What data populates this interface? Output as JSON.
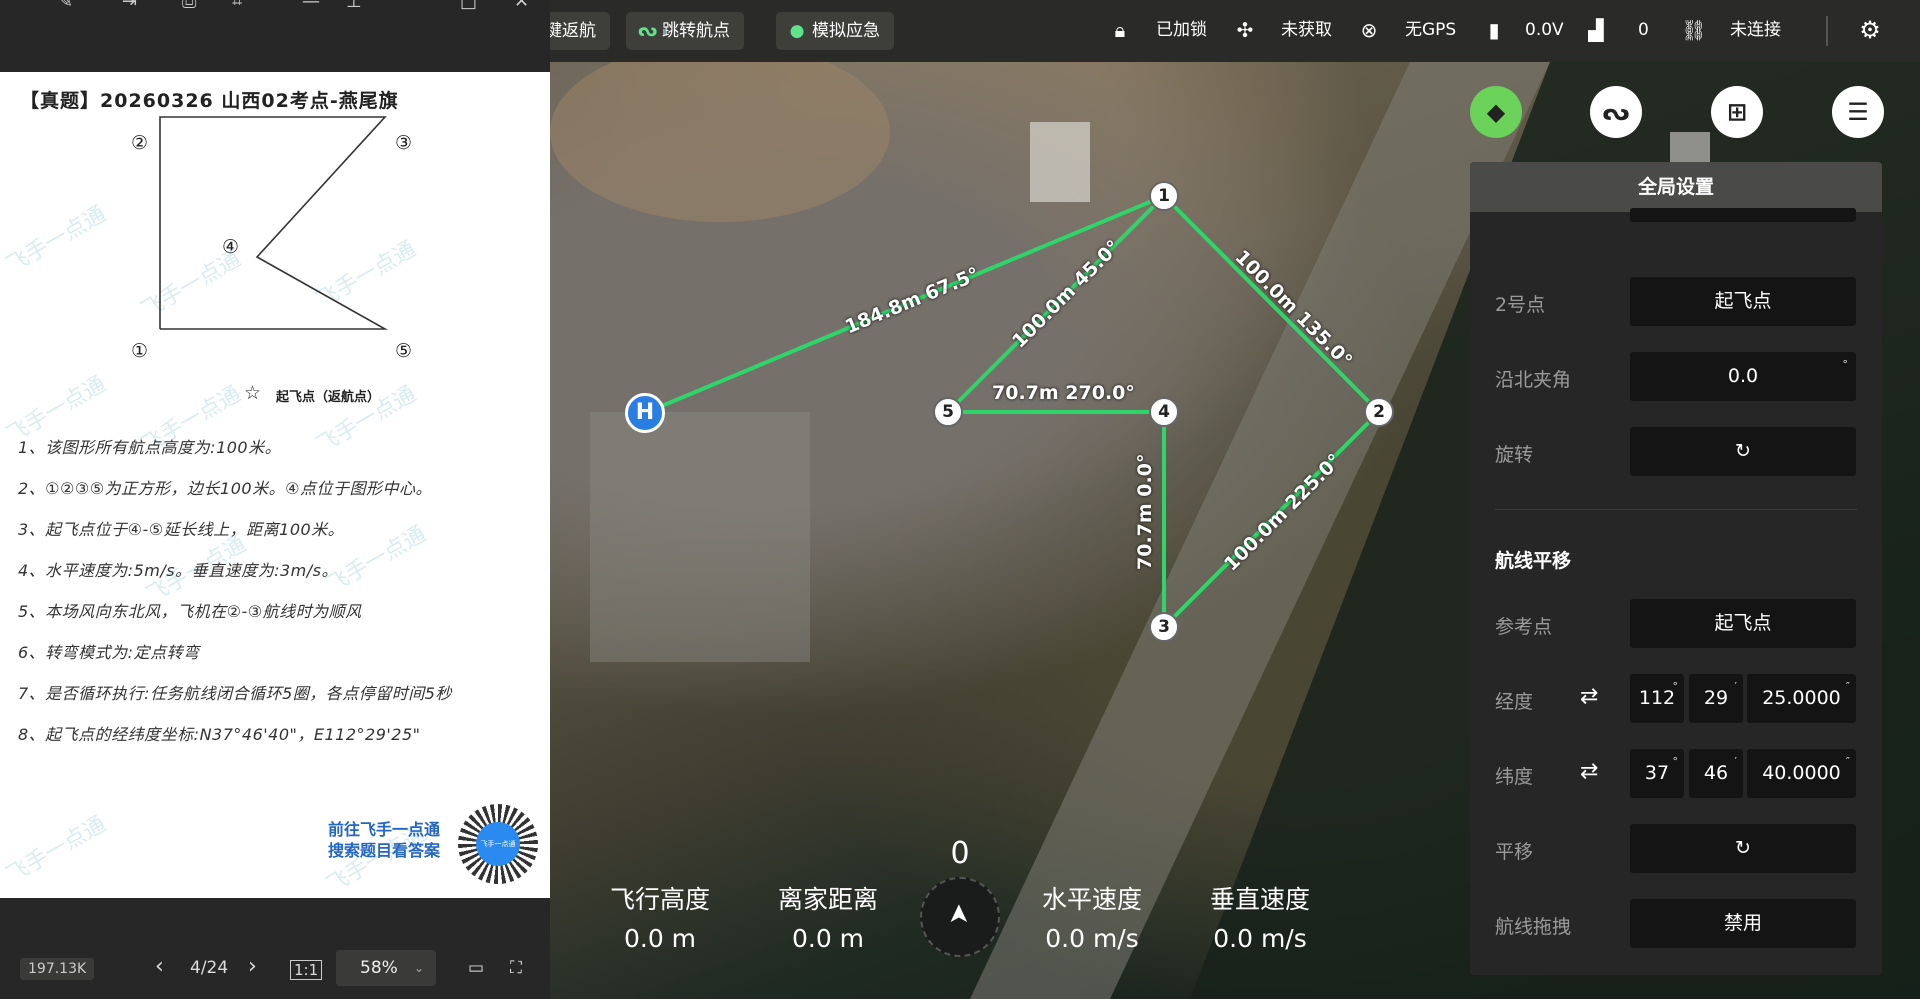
{
  "topbar": {
    "return_label": "键返航",
    "jump_label": "跳转航点",
    "sim_label": "模拟应急",
    "lock_status": "已加锁",
    "drone_status": "未获取",
    "gps_status": "无GPS",
    "voltage": "0.0V",
    "signal_value": "0",
    "connection_status": "未连接"
  },
  "viewer": {
    "doc_title": "【真题】20260326 山西02考点-燕尾旗",
    "diagram_labels": {
      "p1": "①",
      "p2": "②",
      "p3": "③",
      "p4": "④",
      "p5": "⑤",
      "takeoff": "起飞点（返航点）"
    },
    "rules": [
      "1、该图形所有航点高度为:100米。",
      "2、①②③⑤为正方形，边长100米。④点位于图形中心。",
      "3、起飞点位于④-⑤延长线上，距离100米。",
      "4、水平速度为:5m/s。垂直速度为:3m/s。",
      "5、本场风向东北风，飞机在②-③航线时为顺风",
      "6、转弯模式为:定点转弯",
      "7、是否循环执行:任务航线闭合循环5圈，各点停留时间5秒",
      "8、起飞点的经纬度坐标:N37°46'40\"，E112°29'25\""
    ],
    "watermark": "飞手一点通",
    "cta_line1": "前往飞手一点通",
    "cta_line2": "搜索题目看答案",
    "qr_text": "飞手一点通",
    "file_size": "197.13K",
    "page": "4/24",
    "zoom": "58%"
  },
  "panel": {
    "title": "全局设置",
    "point2_label": "2号点",
    "point2_value": "起飞点",
    "north_angle_label": "沿北夹角",
    "north_angle_value": "0.0",
    "north_angle_unit": "°",
    "rotate_label": "旋转",
    "section_title": "航线平移",
    "ref_label": "参考点",
    "ref_value": "起飞点",
    "lon_label": "经度",
    "lon_deg": "112",
    "lon_min": "29",
    "lon_sec": "25.0000",
    "lat_label": "纬度",
    "lat_deg": "37",
    "lat_min": "46",
    "lat_sec": "40.0000",
    "translate_label": "平移",
    "drag_label": "航线拖拽",
    "drag_value": "禁用",
    "deg_unit": "°",
    "min_unit": "′",
    "sec_unit": "″"
  },
  "map": {
    "home_label": "H",
    "waypoints": [
      "1",
      "2",
      "3",
      "4",
      "5"
    ],
    "segments": [
      "184.8m 67.5°",
      "100.0m 45.0°",
      "100.0m 135.0°",
      "70.7m 270.0°",
      "70.7m 0.0°",
      "100.0m 225.0°"
    ],
    "route_color": "#2fd46a"
  },
  "hud": {
    "heading": "0",
    "alt_label": "飞行高度",
    "alt_value": "0.0 m",
    "dist_label": "离家距离",
    "dist_value": "0.0 m",
    "hspeed_label": "水平速度",
    "hspeed_value": "0.0 m/s",
    "vspeed_label": "垂直速度",
    "vspeed_value": "0.0 m/s"
  }
}
